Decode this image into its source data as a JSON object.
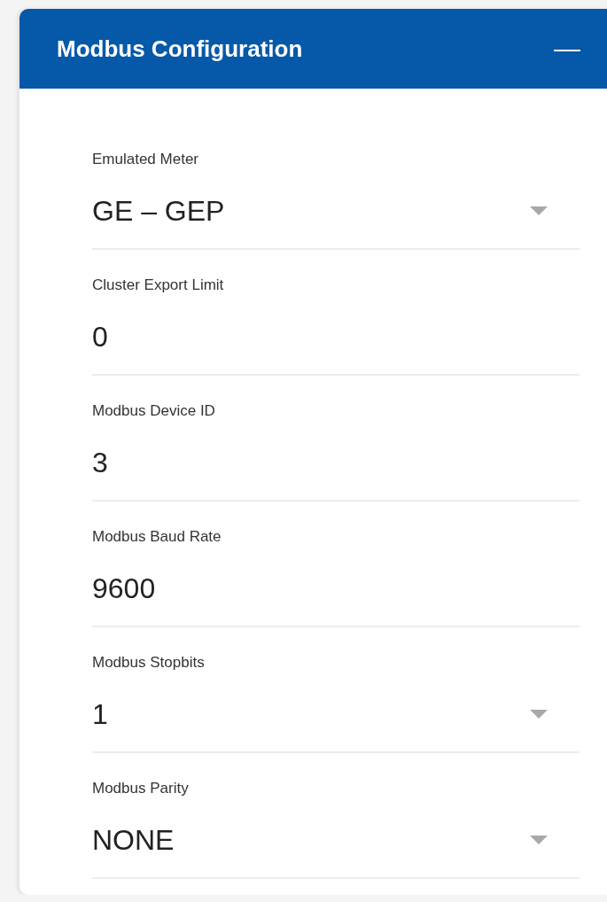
{
  "panel": {
    "title": "Modbus Configuration",
    "collapse_icon": "—"
  },
  "fields": [
    {
      "kind": "select",
      "label": "Emulated Meter",
      "value": "GE – GEP"
    },
    {
      "kind": "text",
      "label": "Cluster Export Limit",
      "value": "0"
    },
    {
      "kind": "text",
      "label": "Modbus Device ID",
      "value": "3"
    },
    {
      "kind": "text",
      "label": "Modbus Baud Rate",
      "value": "9600"
    },
    {
      "kind": "select",
      "label": "Modbus Stopbits",
      "value": "1"
    },
    {
      "kind": "select",
      "label": "Modbus Parity",
      "value": "NONE"
    }
  ]
}
